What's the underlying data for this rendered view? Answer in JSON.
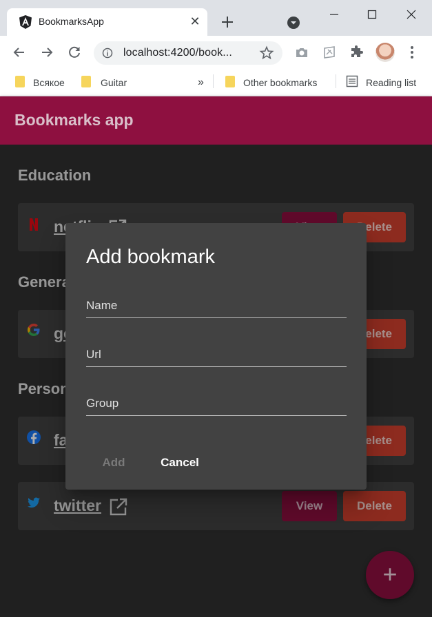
{
  "browser": {
    "tab_title": "BookmarksApp",
    "url": "localhost:4200/book...",
    "bookmarks_bar": {
      "items": [
        {
          "label": "Всякое"
        },
        {
          "label": "Guitar"
        }
      ],
      "overflow": "»",
      "other_bookmarks": "Other bookmarks",
      "reading_list": "Reading list"
    }
  },
  "app": {
    "title": "Bookmarks app",
    "groups": [
      {
        "title": "Education",
        "bookmarks": [
          {
            "name": "netflix",
            "icon": "netflix-icon"
          }
        ]
      },
      {
        "title": "General",
        "bookmarks": [
          {
            "name": "google",
            "icon": "google-icon"
          }
        ]
      },
      {
        "title": "Personal",
        "bookmarks": [
          {
            "name": "facebook",
            "icon": "facebook-icon"
          },
          {
            "name": "twitter",
            "icon": "twitter-icon"
          }
        ]
      }
    ],
    "view_label": "View",
    "delete_label": "Delete",
    "fab_label": "+"
  },
  "dialog": {
    "title": "Add bookmark",
    "fields": {
      "name_label": "Name",
      "url_label": "Url",
      "group_label": "Group"
    },
    "add_label": "Add",
    "cancel_label": "Cancel"
  },
  "colors": {
    "primary": "#8e1040",
    "warn": "#d0402f",
    "background": "#303030",
    "card": "#424242"
  }
}
